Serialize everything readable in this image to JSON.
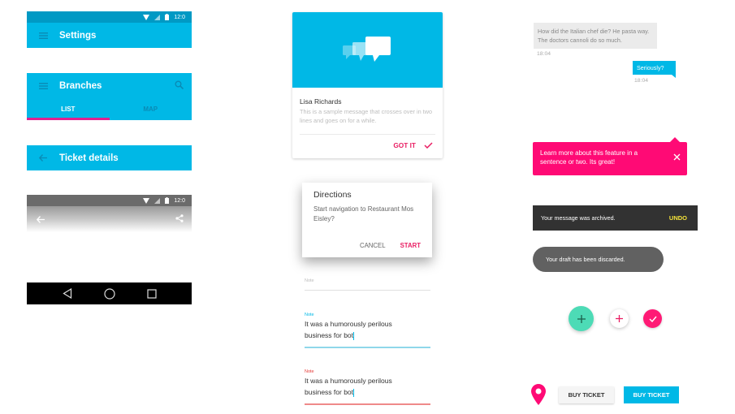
{
  "colors": {
    "primary": "#00b8e6",
    "primary_dark": "#0099c4",
    "accent": "#e91e63",
    "tooltip_pink": "#ff0a75",
    "tab_indicator": "#e0208f",
    "fab_teal": "#4ddbb6",
    "snackbar_bg": "#323232",
    "snackbar_action": "#f5e33a",
    "toast_bg": "#616161",
    "error": "#e53935"
  },
  "status_bar": {
    "time": "12:0",
    "icons": [
      "wifi-icon",
      "signal-icon",
      "battery-icon"
    ]
  },
  "appbars": {
    "settings": {
      "title": "Settings",
      "nav_icon": "menu-icon"
    },
    "branches": {
      "title": "Branches",
      "nav_icon": "menu-icon",
      "action_icon": "search-icon",
      "tabs": [
        {
          "label": "LIST",
          "active": true
        },
        {
          "label": "MAP",
          "active": false
        }
      ]
    },
    "ticket_details": {
      "title": "Ticket details",
      "nav_icon": "arrow-back-icon"
    },
    "transparent": {
      "nav_icon": "arrow-back-icon",
      "action_icon": "share-icon",
      "time": "12:0"
    }
  },
  "nav_bar": {
    "buttons": [
      "back-triangle-icon",
      "home-circle-icon",
      "recents-square-icon"
    ]
  },
  "card": {
    "media_icon": "chat-bubbles-icon",
    "title": "Lisa Richards",
    "text": "This is a sample message that crosses over in two lines and goes on for a while.",
    "action_label": "GOT IT",
    "action_icon": "check-icon"
  },
  "dialog": {
    "title": "Directions",
    "text": "Start navigation to Restaurant Mos Eisley?",
    "cancel": "CANCEL",
    "confirm": "START"
  },
  "fields": [
    {
      "state": "empty",
      "label": "Note",
      "value": ""
    },
    {
      "state": "focused",
      "label": "Note",
      "value_line1": "It was a humorously perilous",
      "value_line2": "business for bot"
    },
    {
      "state": "error",
      "label": "Note",
      "value_line1": "It was a humorously perilous",
      "value_line2": "business for bot"
    }
  ],
  "chat": {
    "incoming": {
      "text": "How did the Italian chef die? He pasta way. The doctors cannoli do so much.",
      "time": "18:04"
    },
    "outgoing": {
      "text": "Seriously?",
      "time": "18:04"
    }
  },
  "tooltip": {
    "text": "Learn more about this feature in a sentence or two. Its great!",
    "close_icon": "close-icon"
  },
  "snackbar": {
    "text": "Your message was archived.",
    "action": "UNDO"
  },
  "toast": {
    "text": "Your draft has been discarded."
  },
  "fabs": [
    {
      "name": "add",
      "icon": "plus-icon",
      "style": "teal-large"
    },
    {
      "name": "add",
      "icon": "plus-icon",
      "style": "white-mini"
    },
    {
      "name": "done",
      "icon": "check-icon",
      "style": "pink-mini"
    }
  ],
  "buttons": {
    "location_icon": "map-pin-icon",
    "flat": "BUY TICKET",
    "raised": "BUY TICKET"
  }
}
